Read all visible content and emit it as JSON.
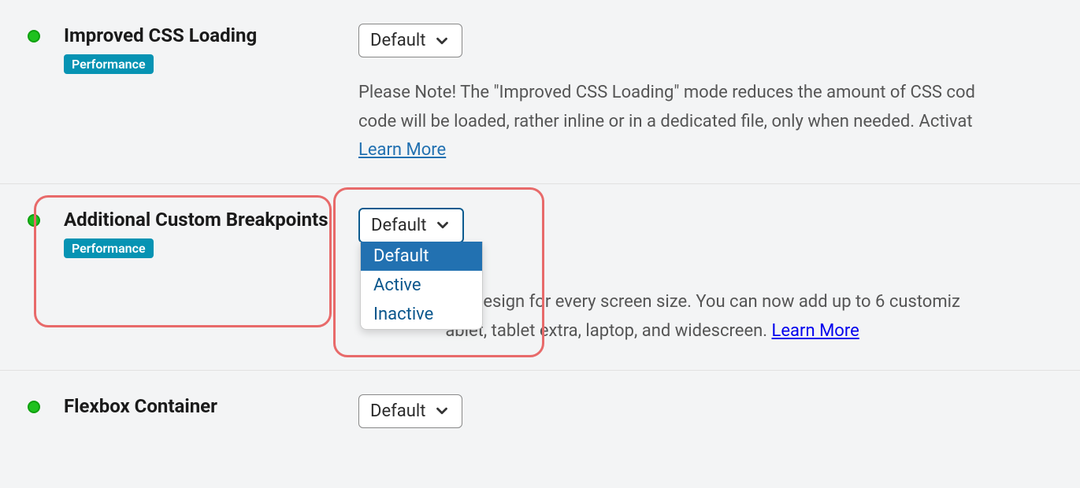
{
  "settings": [
    {
      "title": "Improved CSS Loading",
      "tag": "Performance",
      "select_value": "Default",
      "description_pre": "Please Note! The \"Improved CSS Loading\" mode reduces the amount of CSS cod",
      "description_line2": "code will be loaded, rather inline or in a dedicated file, only when needed. Activat",
      "learn_more": "Learn More"
    },
    {
      "title": "Additional Custom Breakpoints",
      "tag": "Performance",
      "select_value": "Default",
      "options": [
        "Default",
        "Active",
        "Inactive"
      ],
      "description_part1": "ect design for every screen size. You can now add up to 6 customiz",
      "description_part2a": "ablet, tablet extra, laptop, and widescreen. ",
      "learn_more": "Learn More"
    },
    {
      "title": "Flexbox Container",
      "select_value": "Default"
    }
  ]
}
